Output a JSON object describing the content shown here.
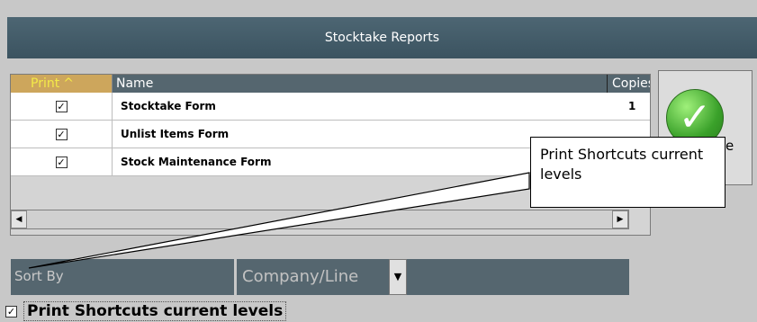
{
  "window": {
    "title": "Stocktake Reports"
  },
  "grid": {
    "columns": {
      "print": "Print",
      "name": "Name",
      "copies": "Copies"
    },
    "rows": [
      {
        "checked": true,
        "name": "Stocktake Form",
        "copies": "1"
      },
      {
        "checked": true,
        "name": "Unlist Items Form",
        "copies": ""
      },
      {
        "checked": true,
        "name": "Stock Maintenance Form",
        "copies": ""
      }
    ]
  },
  "ok_button": {
    "label": "e"
  },
  "sort": {
    "label": "Sort By",
    "value": "Company/Line"
  },
  "print_shortcuts": {
    "checked": true,
    "label": "Print Shortcuts current levels"
  },
  "callout": {
    "text": "Print Shortcuts current levels"
  },
  "colors": {
    "header": "#55666f",
    "accent_header": "#cda65c",
    "accent_text": "#f4ea48"
  }
}
